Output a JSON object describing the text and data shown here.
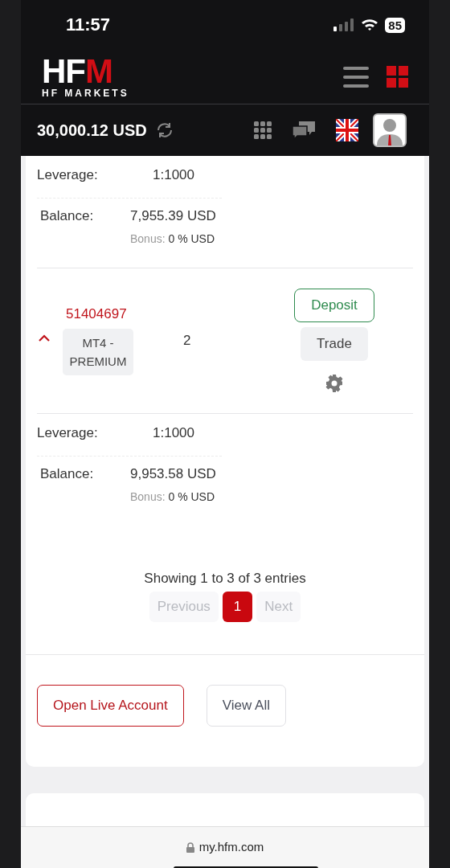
{
  "status_bar": {
    "time": "11:57",
    "battery": "85"
  },
  "header": {
    "logo": {
      "main": "HF",
      "accent": "M",
      "tagline": "HF MARKETS"
    }
  },
  "toolbar": {
    "balance": "30,000.12 USD"
  },
  "accounts": [
    {
      "details": [
        {
          "kind": "leverage",
          "label": "Leverage:",
          "value": "1:1000"
        },
        {
          "kind": "balance",
          "label": "Balance:",
          "value": "7,955.39 USD",
          "bonus_label": "Bonus:",
          "bonus_value": "0 % USD"
        }
      ]
    },
    {
      "expanded": true,
      "number": "51404697",
      "type": "MT4 - PREMIUM",
      "column_3": "2",
      "deposit": "Deposit",
      "trade": "Trade",
      "details": [
        {
          "kind": "leverage",
          "label": "Leverage:",
          "value": "1:1000"
        },
        {
          "kind": "balance",
          "label": "Balance:",
          "value": "9,953.58 USD",
          "bonus_label": "Bonus:",
          "bonus_value": "0 % USD"
        }
      ]
    }
  ],
  "pagination": {
    "info": "Showing 1 to 3 of 3 entries",
    "items": [
      {
        "label": "Previous",
        "kind": "nav",
        "disabled": true,
        "selected": false
      },
      {
        "label": "1",
        "kind": "page",
        "disabled": false,
        "selected": true
      },
      {
        "label": "Next",
        "kind": "nav",
        "disabled": true,
        "selected": false
      }
    ]
  },
  "actions": [
    {
      "label": "Open Live Account",
      "kind": "primary"
    },
    {
      "label": "View All",
      "kind": "secondary"
    }
  ],
  "browser": {
    "url": "my.hfm.com"
  }
}
